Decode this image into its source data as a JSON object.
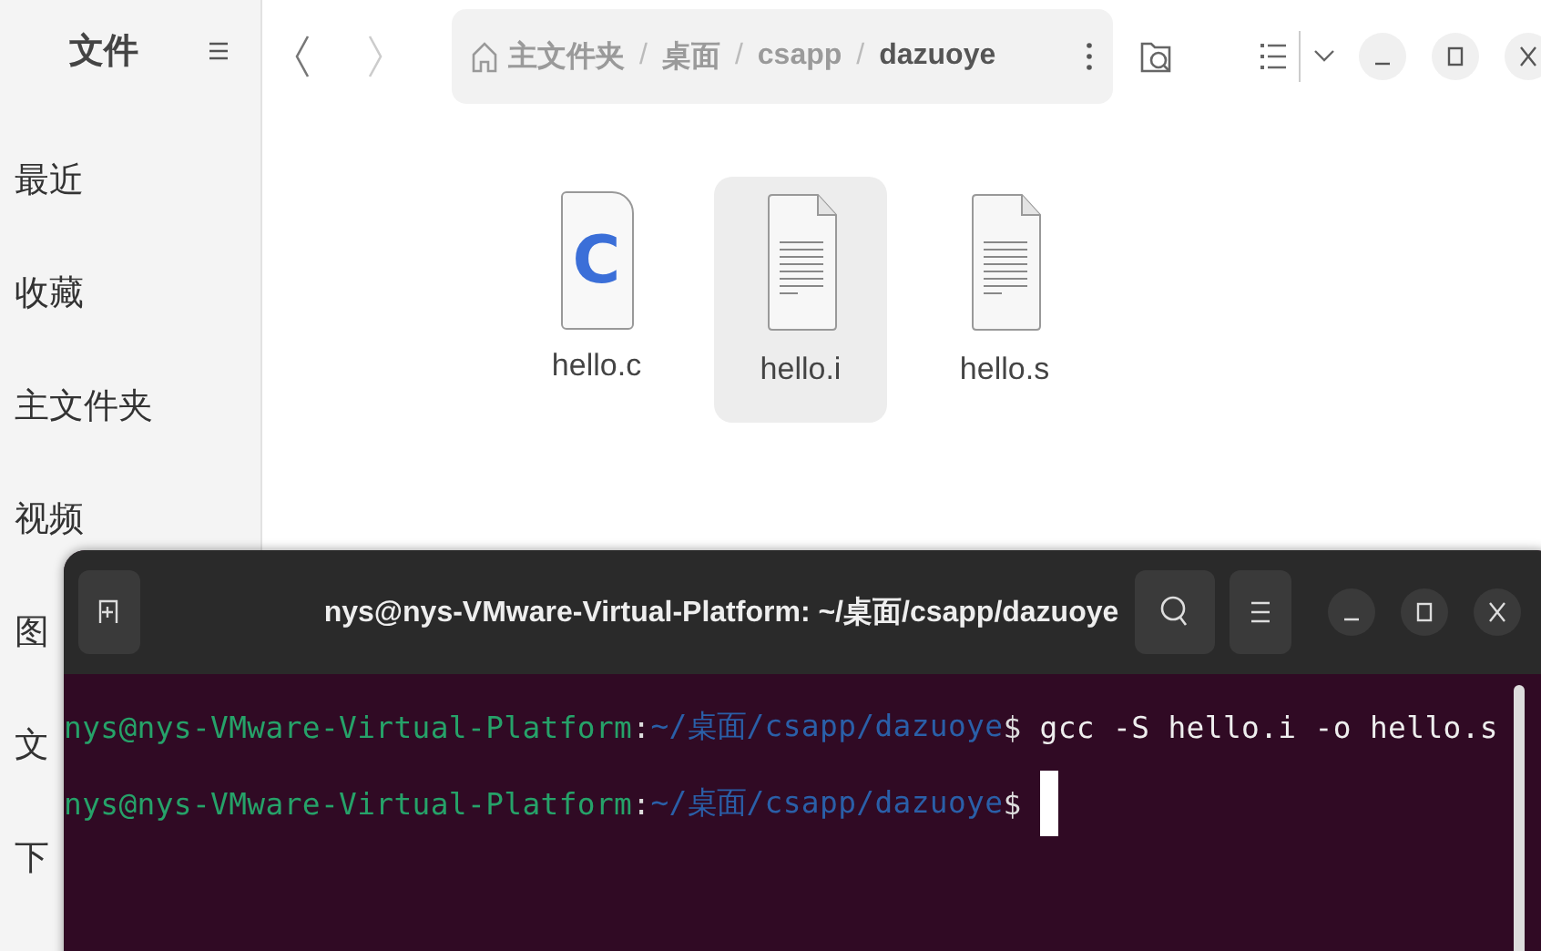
{
  "file_manager": {
    "title": "文件",
    "sidebar": {
      "items": [
        {
          "label": "最近"
        },
        {
          "label": "收藏"
        },
        {
          "label": "主文件夹"
        },
        {
          "label": "视频"
        },
        {
          "label": "图"
        },
        {
          "label": "文"
        },
        {
          "label": "下"
        }
      ]
    },
    "breadcrumb": {
      "separator": "/",
      "items": [
        {
          "label": "主文件夹",
          "kind": "home",
          "selected": false
        },
        {
          "label": "桌面",
          "kind": "folder",
          "selected": false
        },
        {
          "label": "csapp",
          "kind": "folder",
          "selected": false
        },
        {
          "label": "dazuoye",
          "kind": "folder",
          "selected": true
        }
      ]
    },
    "files": [
      {
        "name": "hello.c",
        "kind": "c",
        "glyph": "C",
        "selected": false
      },
      {
        "name": "hello.i",
        "kind": "text",
        "selected": true
      },
      {
        "name": "hello.s",
        "kind": "text",
        "selected": false
      }
    ]
  },
  "terminal": {
    "title": "nys@nys-VMware-Virtual-Platform: ~/桌面/csapp/dazuoye",
    "lines": [
      {
        "user": "nys@nys-VMware-Virtual-Platform",
        "colon": ":",
        "path": "~/桌面/csapp/dazuoye",
        "prompt": "$",
        "command": "gcc -S hello.i -o hello.s",
        "cursor": false
      },
      {
        "user": "nys@nys-VMware-Virtual-Platform",
        "colon": ":",
        "path": "~/桌面/csapp/dazuoye",
        "prompt": "$",
        "cursor": true
      }
    ]
  }
}
